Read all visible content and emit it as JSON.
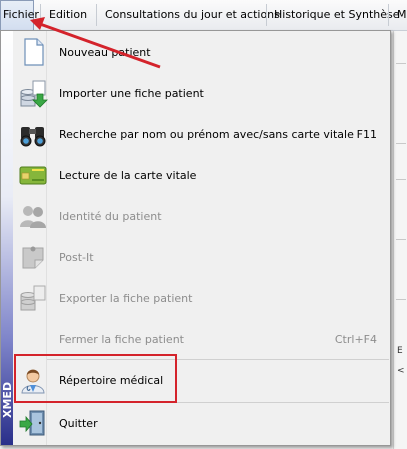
{
  "menubar": {
    "items": [
      {
        "label": "Fichier"
      },
      {
        "label": "Edition"
      },
      {
        "label": "Consultations du jour et actions"
      },
      {
        "label": "Historique et Synthèse"
      },
      {
        "label": "M"
      }
    ]
  },
  "side_label": "XMED",
  "menu": {
    "items": [
      {
        "label": "Nouveau patient",
        "icon": "document-icon",
        "enabled": true
      },
      {
        "label": "Importer une fiche patient",
        "icon": "import-icon",
        "enabled": true
      },
      {
        "label": "Recherche par nom ou prénom avec/sans carte vitale",
        "shortcut": "F11",
        "icon": "binoculars-icon",
        "enabled": true
      },
      {
        "label": "Lecture de la carte vitale",
        "icon": "vitale-card-icon",
        "enabled": true
      },
      {
        "label": "Identité du patient",
        "icon": "users-icon",
        "enabled": false
      },
      {
        "label": "Post-It",
        "icon": "post-it-icon",
        "enabled": false
      },
      {
        "label": "Exporter la fiche patient",
        "icon": "export-icon",
        "enabled": false
      },
      {
        "label": "Fermer la fiche patient",
        "shortcut": "Ctrl+F4",
        "enabled": false
      },
      {
        "label": "Répertoire médical",
        "icon": "doctor-icon",
        "enabled": true
      },
      {
        "label": "Quitter",
        "icon": "exit-door-icon",
        "enabled": true
      }
    ]
  },
  "annotations": {
    "arrow_color": "#d4232b",
    "highlight_color": "#d4232b"
  },
  "background_right": {
    "fragments": [
      "E",
      "<"
    ]
  }
}
